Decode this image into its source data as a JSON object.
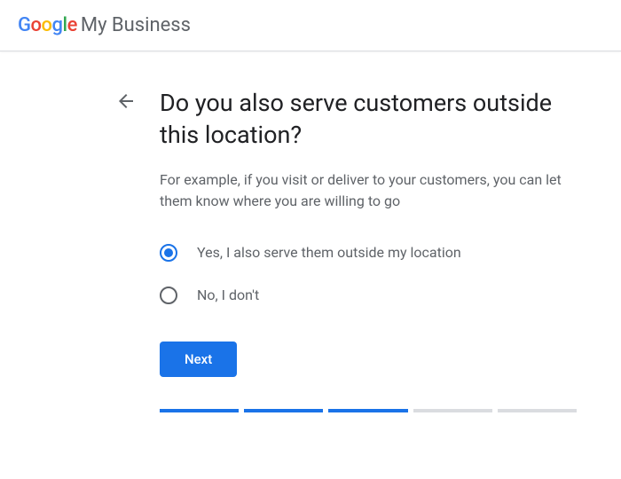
{
  "header": {
    "product_name": "My Business"
  },
  "page": {
    "title": "Do you also serve customers outside this location?",
    "description": "For example, if you visit or deliver to your customers, you can let them know where you are willing to go",
    "options": [
      {
        "label": "Yes, I also serve them outside my location",
        "selected": true
      },
      {
        "label": "No, I don't",
        "selected": false
      }
    ],
    "next_button": "Next"
  },
  "progress": {
    "completed": 3,
    "total": 5
  }
}
